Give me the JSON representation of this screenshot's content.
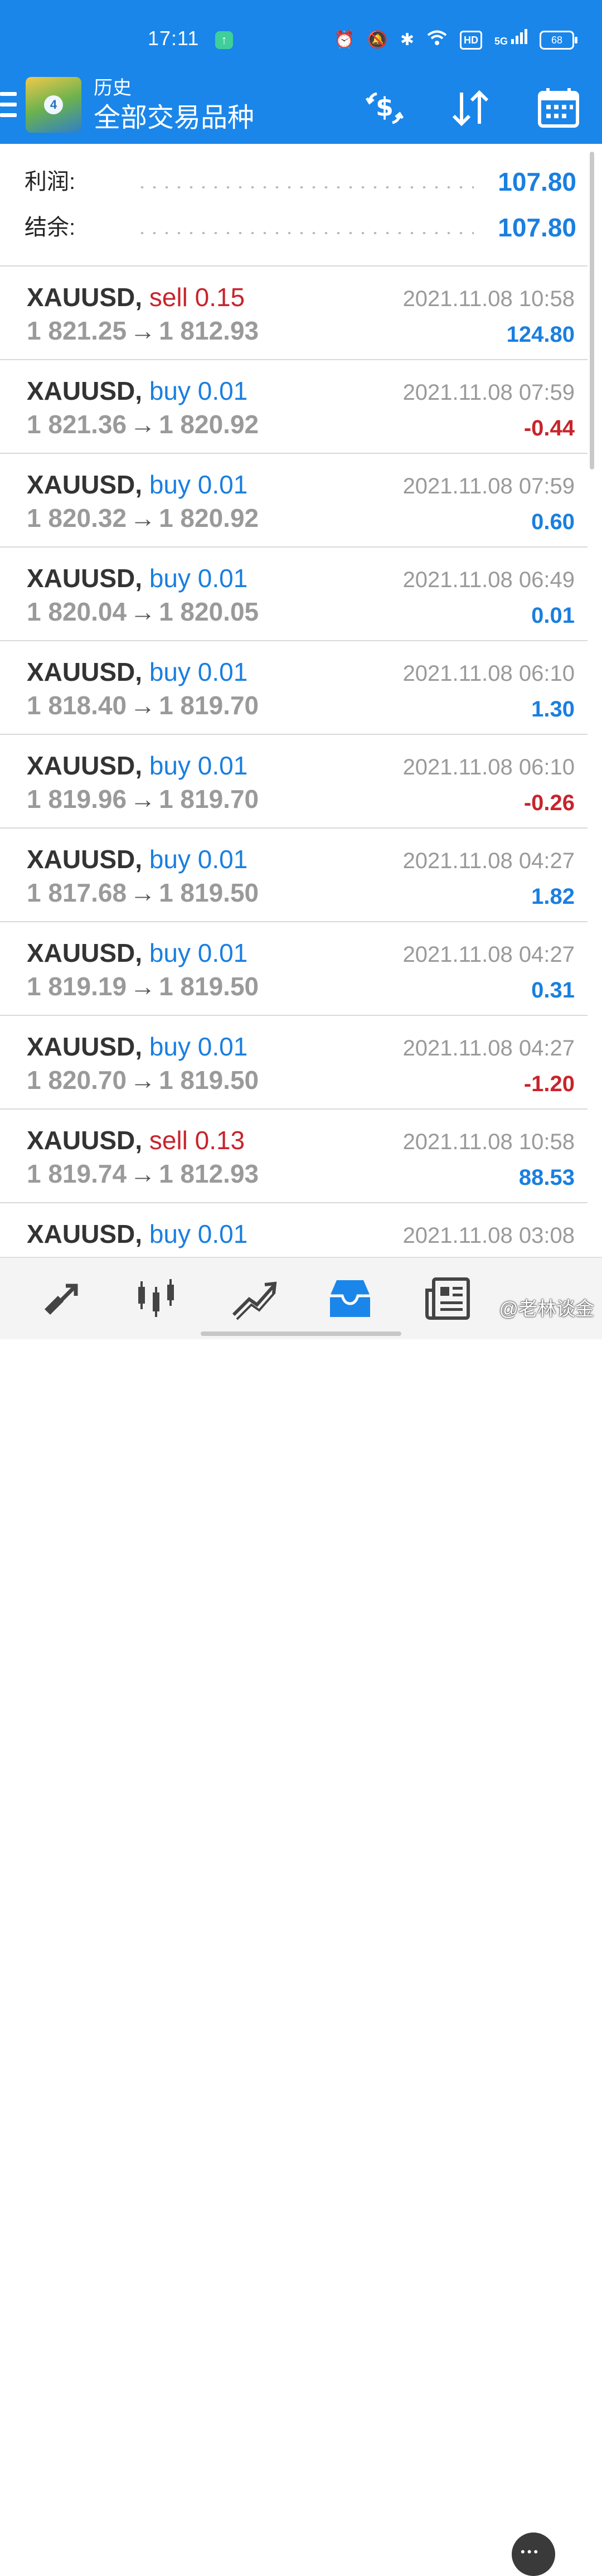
{
  "status_bar": {
    "time": "17:11",
    "badge": "HD",
    "network": "5G",
    "battery": "68"
  },
  "app_bar": {
    "title": "历史",
    "subtitle": "全部交易品种"
  },
  "summary": [
    {
      "label": "利润:",
      "value": "107.80"
    },
    {
      "label": "结余:",
      "value": "107.80"
    }
  ],
  "trades": [
    {
      "symbol": "XAUUSD,",
      "side": "sell 0.15",
      "open": "1 821.25",
      "close": "1 812.93",
      "arrow": "→",
      "time": "2021.11.08 10:58",
      "profit": "124.80"
    },
    {
      "symbol": "XAUUSD,",
      "side": "buy 0.01",
      "open": "1 821.36",
      "close": "1 820.92",
      "arrow": "→",
      "time": "2021.11.08 07:59",
      "profit": "-0.44"
    },
    {
      "symbol": "XAUUSD,",
      "side": "buy 0.01",
      "open": "1 820.32",
      "close": "1 820.92",
      "arrow": "→",
      "time": "2021.11.08 07:59",
      "profit": "0.60"
    },
    {
      "symbol": "XAUUSD,",
      "side": "buy 0.01",
      "open": "1 820.04",
      "close": "1 820.05",
      "arrow": "→",
      "time": "2021.11.08 06:49",
      "profit": "0.01"
    },
    {
      "symbol": "XAUUSD,",
      "side": "buy 0.01",
      "open": "1 818.40",
      "close": "1 819.70",
      "arrow": "→",
      "time": "2021.11.08 06:10",
      "profit": "1.30"
    },
    {
      "symbol": "XAUUSD,",
      "side": "buy 0.01",
      "open": "1 819.96",
      "close": "1 819.70",
      "arrow": "→",
      "time": "2021.11.08 06:10",
      "profit": "-0.26"
    },
    {
      "symbol": "XAUUSD,",
      "side": "buy 0.01",
      "open": "1 817.68",
      "close": "1 819.50",
      "arrow": "→",
      "time": "2021.11.08 04:27",
      "profit": "1.82"
    },
    {
      "symbol": "XAUUSD,",
      "side": "buy 0.01",
      "open": "1 819.19",
      "close": "1 819.50",
      "arrow": "→",
      "time": "2021.11.08 04:27",
      "profit": "0.31"
    },
    {
      "symbol": "XAUUSD,",
      "side": "buy 0.01",
      "open": "1 820.70",
      "close": "1 819.50",
      "arrow": "→",
      "time": "2021.11.08 04:27",
      "profit": "-1.20"
    },
    {
      "symbol": "XAUUSD,",
      "side": "sell 0.13",
      "open": "1 819.74",
      "close": "1 812.93",
      "arrow": "→",
      "time": "2021.11.08 10:58",
      "profit": "88.53"
    },
    {
      "symbol": "XAUUSD,",
      "side": "buy 0.01",
      "open": "",
      "close": "",
      "arrow": "",
      "time": "2021.11.08 03:08",
      "profit": ""
    }
  ],
  "bottom_nav": [
    {
      "icon": "quotes-icon"
    },
    {
      "icon": "chart-icon"
    },
    {
      "icon": "trade-icon"
    },
    {
      "icon": "history-icon",
      "active": true
    },
    {
      "icon": "news-icon"
    },
    {
      "icon": "messages-icon"
    }
  ],
  "watermark": "@老林谈金",
  "colors": {
    "accent": "#1a86ea",
    "profit_positive": "#1a7fe0",
    "profit_negative": "#c8242c",
    "sell": "#c8242c",
    "buy": "#1a7fe0"
  }
}
